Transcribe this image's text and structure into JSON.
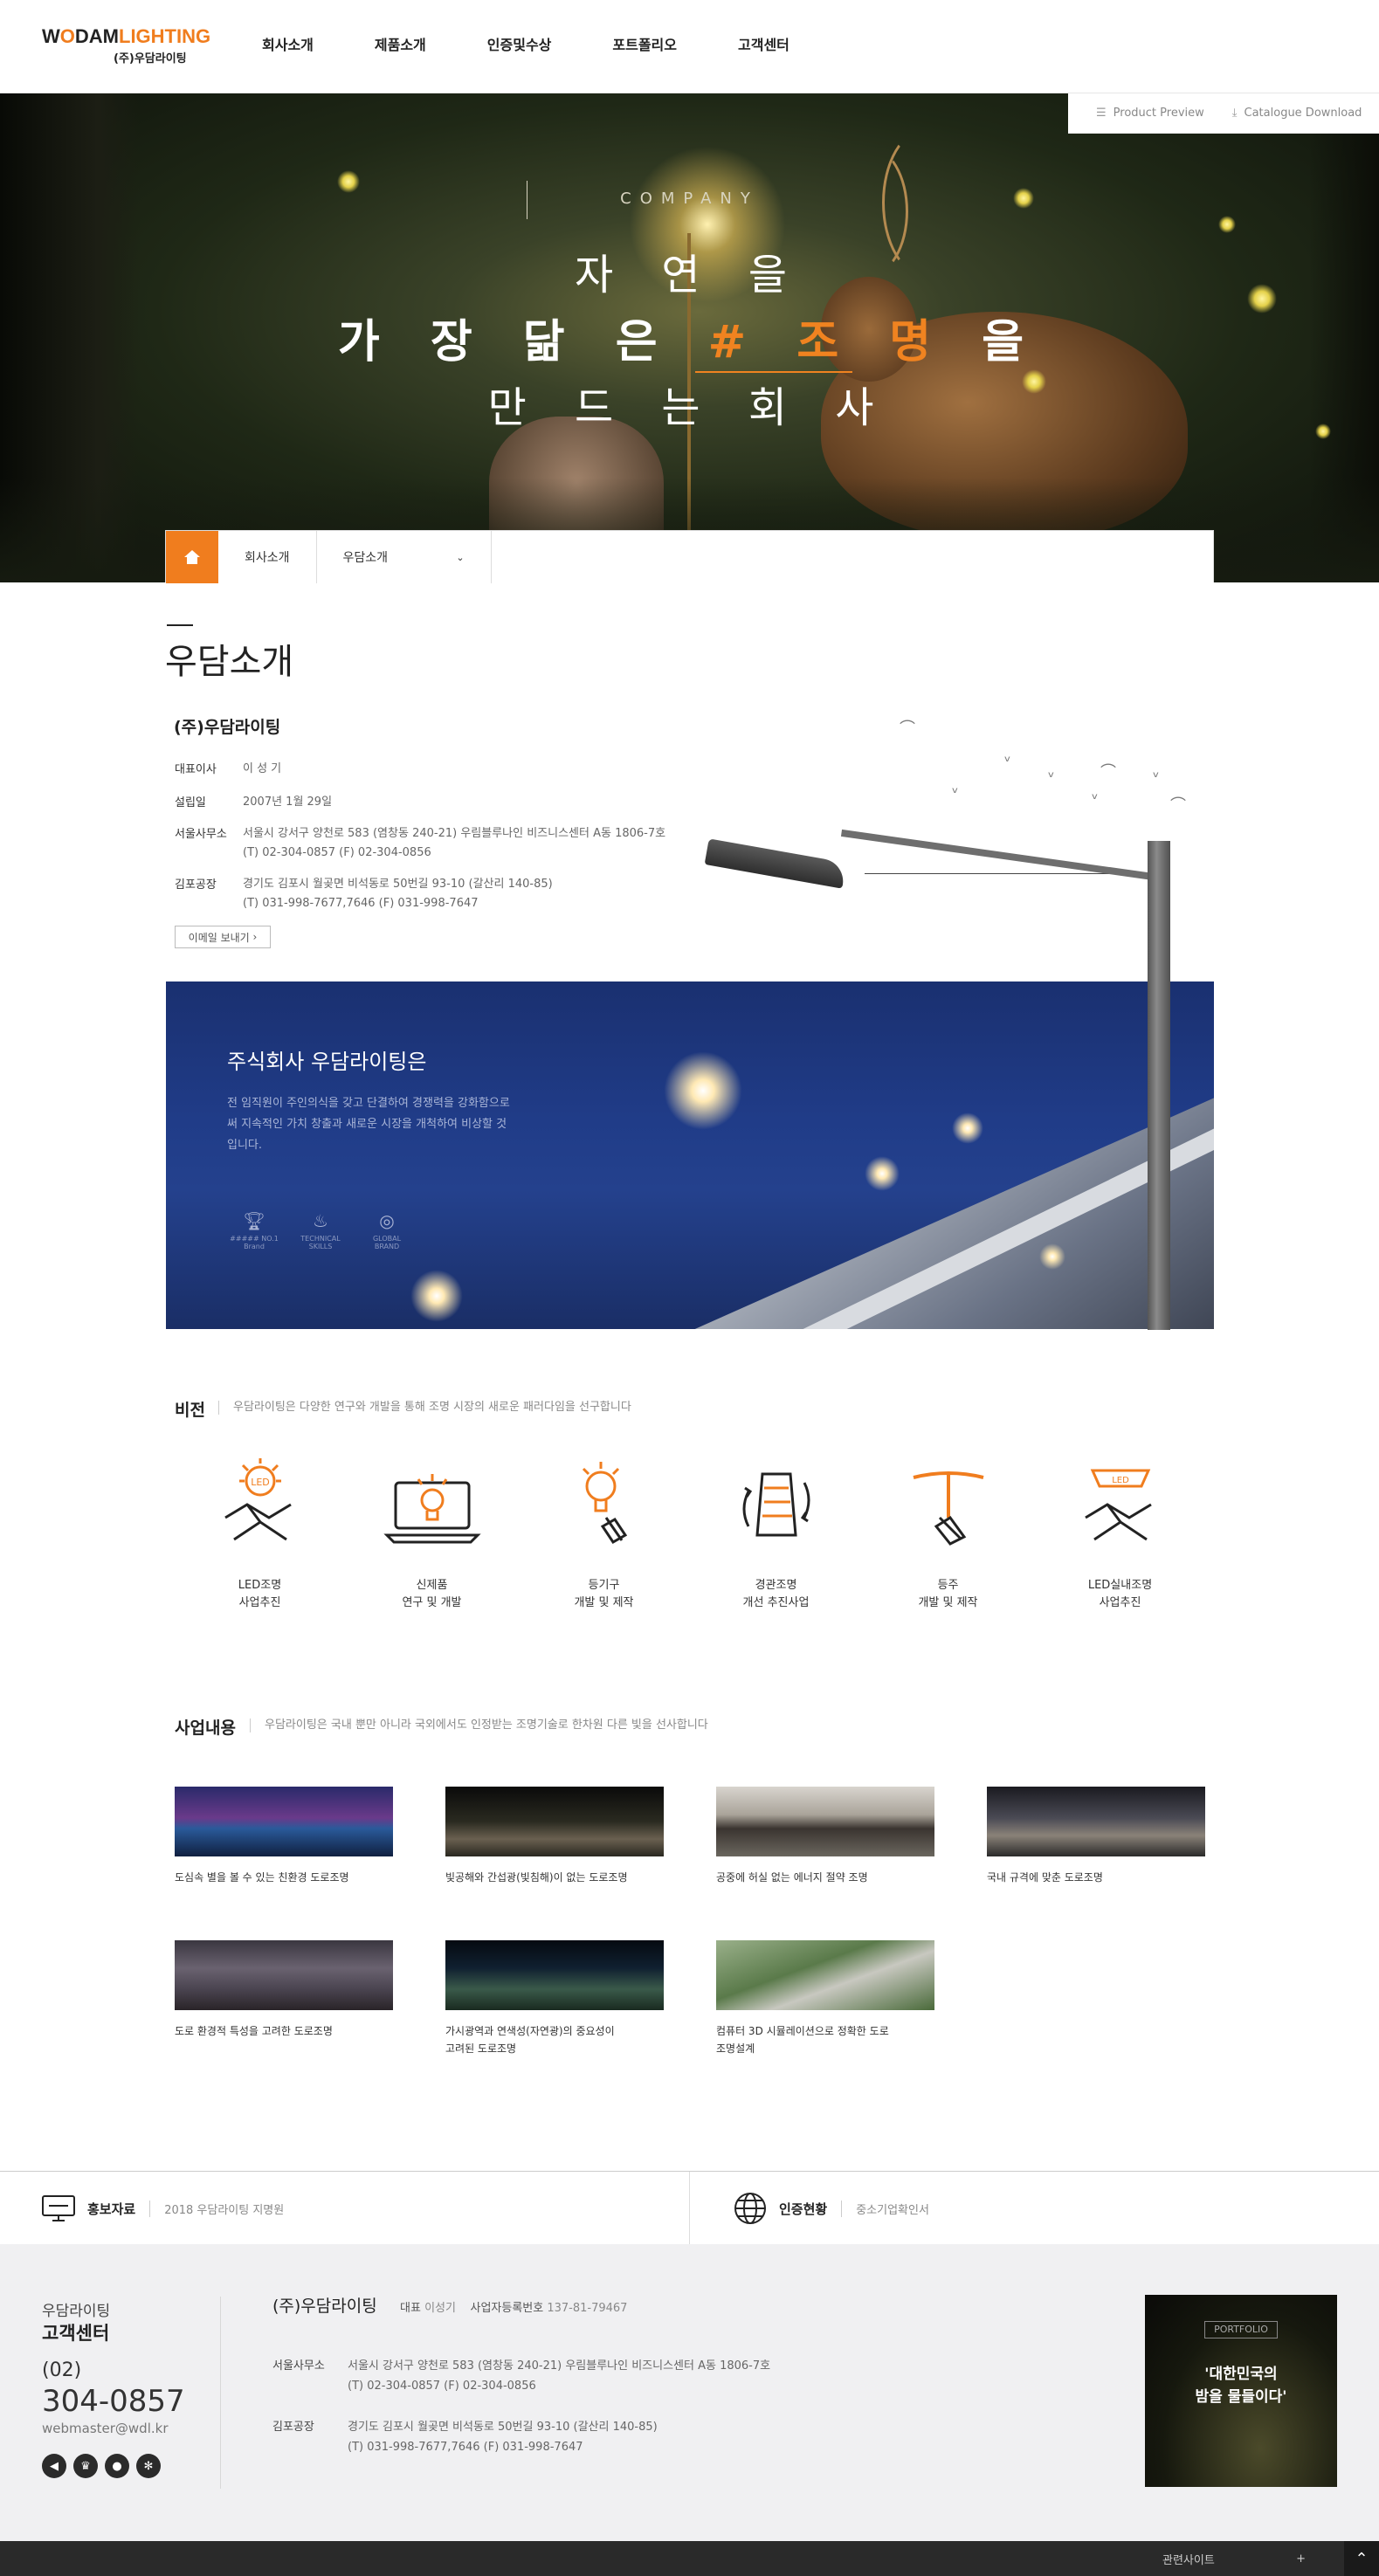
{
  "header": {
    "logo_main_1": "W",
    "logo_main_o": "O",
    "logo_main_2": "DAM",
    "logo_main_3": "LIGHTING",
    "logo_sub": "(주)우담라이팅",
    "nav": [
      "회사소개",
      "제품소개",
      "인증및수상",
      "포트폴리오",
      "고객센터"
    ]
  },
  "quick_links": {
    "preview": "Product Preview",
    "catalogue": "Catalogue Download"
  },
  "hero": {
    "subtitle": "COMPANY",
    "line1": "자 연 을",
    "line2_pre": "가 장 닮 은 ",
    "line2_hl": "# 조 명",
    "line2_post": " 을",
    "line3": "만 드 는 회 사"
  },
  "breadcrumb": {
    "level1": "회사소개",
    "level2": "우담소개"
  },
  "about": {
    "title": "우담소개",
    "company": "(주)우담라이팅",
    "rows": [
      {
        "k": "대표이사",
        "v1": "이 성 기",
        "v2": ""
      },
      {
        "k": "설립일",
        "v1": "2007년 1월 29일",
        "v2": ""
      },
      {
        "k": "서울사무소",
        "v1": "서울시 강서구 양천로 583 (염창동 240-21) 우림블루나인 비즈니스센터 A동 1806-7호",
        "v2": "(T) 02-304-0857 (F) 02-304-0856"
      },
      {
        "k": "김포공장",
        "v1": "경기도 김포시 월곶면 비석동로 50번길 93-10 (갈산리 140-85)",
        "v2": "(T) 031-998-7677,7646 (F) 031-998-7647"
      }
    ],
    "email_button": "이메일 보내기"
  },
  "banner": {
    "title": "주식회사 우담라이팅은",
    "text": "전 임직원이 주인의식을 갖고 단결하여 경쟁력을 강화함으로써 지속적인 가치 창출과 새로운 시장을 개척하여 비상할 것입니다.",
    "badges": [
      "##### NO.1 Brand",
      "TECHNICAL SKILLS",
      "GLOBAL BRAND"
    ]
  },
  "vision": {
    "title": "비전",
    "desc": "우담라이팅은 다양한 연구와 개발을 통해 조명 시장의 새로운 패러다임을 선구합니다",
    "items": [
      {
        "l1": "LED조명",
        "l2": "사업추진"
      },
      {
        "l1": "신제품",
        "l2": "연구 및 개발"
      },
      {
        "l1": "등기구",
        "l2": "개발 및 제작"
      },
      {
        "l1": "경관조명",
        "l2": "개선 추진사업"
      },
      {
        "l1": "등주",
        "l2": "개발 및 제작"
      },
      {
        "l1": "LED실내조명",
        "l2": "사업추진"
      }
    ]
  },
  "business": {
    "title": "사업내용",
    "desc": "우담라이팅은 국내 뿐만 아니라 국외에서도 인정받는 조명기술로 한차원 다른 빛을 선사합니다",
    "items": [
      {
        "l1": "도심속 별을 볼 수 있는 친환경 도로조명",
        "l2": ""
      },
      {
        "l1": "빛공해와 간섭광(빛침해)이 없는 도로조명",
        "l2": ""
      },
      {
        "l1": "공중에 허실 없는 에너지 절약 조명",
        "l2": ""
      },
      {
        "l1": "국내 규격에 맞춘 도로조명",
        "l2": ""
      },
      {
        "l1": "도로 환경적 특성을 고려한 도로조명",
        "l2": ""
      },
      {
        "l1": "가시광역과 연색성(자연광)의 중요성이",
        "l2": "고려된 도로조명"
      },
      {
        "l1": "컴퓨터 3D 시뮬레이션으로 정확한 도로",
        "l2": "조명설계"
      }
    ]
  },
  "footer_top": {
    "left_title": "홍보자료",
    "left_text": "2018 우담라이팅 지명원",
    "right_title": "인증현황",
    "right_text": "중소기업확인서"
  },
  "footer": {
    "cs_small": "우담라이팅",
    "cs_big": "고객센터",
    "phone_area": "(02)",
    "phone": "304-0857",
    "email": "webmaster@wdl.kr",
    "company": "(주)우담라이팅",
    "rep_label": "대표",
    "rep_name": "이성기",
    "biz_label": "사업자등록번호",
    "biz_no": "137-81-79467",
    "addresses": [
      {
        "k": "서울사무소",
        "v1": "서울시 강서구 양천로 583 (염창동 240-21) 우림블루나인 비즈니스센터 A동 1806-7호",
        "v2": "(T) 02-304-0857 (F) 02-304-0856"
      },
      {
        "k": "김포공장",
        "v1": "경기도 김포시 월곶면 비석동로 50번길 93-10 (갈산리 140-85)",
        "v2": "(T) 031-998-7677,7646 (F) 031-998-7647"
      }
    ],
    "portfolio_badge": "PORTFOLIO",
    "portfolio_l1": "'대한민국의",
    "portfolio_l2": "밤을 물들이다'",
    "related": "관련사이트",
    "related_plus": "+"
  }
}
